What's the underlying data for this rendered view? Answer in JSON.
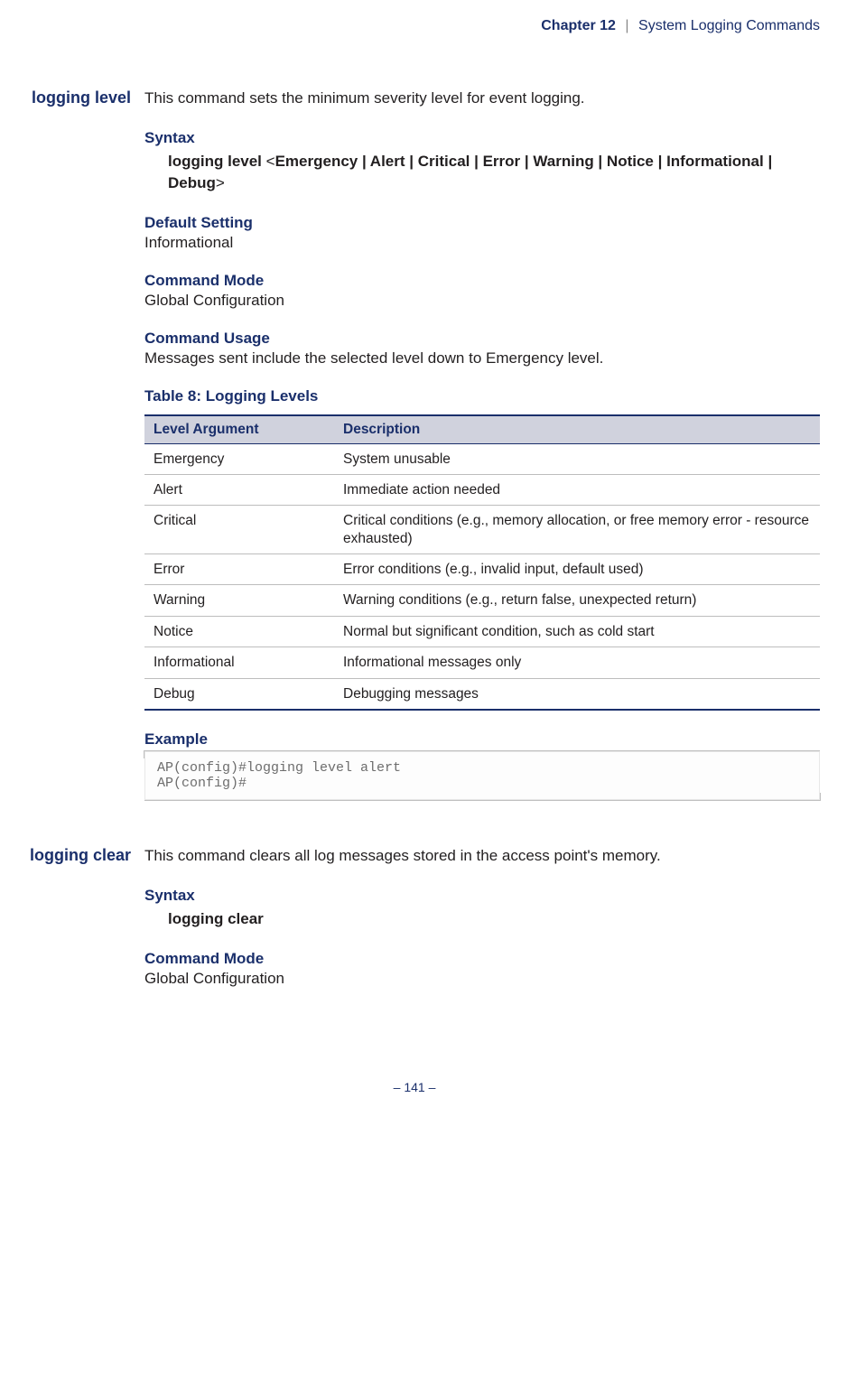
{
  "header": {
    "chapter": "Chapter 12",
    "sep": "|",
    "title": "System Logging Commands"
  },
  "cmd1": {
    "side": "logging level",
    "desc": "This command sets the minimum severity level for event logging.",
    "syntax_h": "Syntax",
    "syntax_lead": "logging level",
    "syntax_opts": "Emergency | Alert | Critical | Error | Warning | Notice | Informational | Debug",
    "default_h": "Default Setting",
    "default_v": "Informational",
    "mode_h": "Command Mode",
    "mode_v": "Global Configuration",
    "usage_h": "Command Usage",
    "usage_v": "Messages sent include the selected level down to Emergency level.",
    "table_title": "Table 8: Logging Levels",
    "table_col1": "Level Argument",
    "table_col2": "Description",
    "levels": [
      {
        "arg": "Emergency",
        "desc": "System unusable"
      },
      {
        "arg": "Alert",
        "desc": "Immediate action needed"
      },
      {
        "arg": "Critical",
        "desc": "Critical conditions (e.g., memory allocation, or free memory error - resource exhausted)"
      },
      {
        "arg": "Error",
        "desc": "Error conditions (e.g., invalid input, default used)"
      },
      {
        "arg": "Warning",
        "desc": "Warning conditions (e.g., return false, unexpected return)"
      },
      {
        "arg": "Notice",
        "desc": "Normal but significant condition, such as cold start"
      },
      {
        "arg": "Informational",
        "desc": "Informational messages only"
      },
      {
        "arg": "Debug",
        "desc": "Debugging messages"
      }
    ],
    "example_h": "Example",
    "example_code": "AP(config)#logging level alert\nAP(config)#"
  },
  "cmd2": {
    "side": "logging clear",
    "desc": "This command clears all log messages stored in the access point's memory.",
    "syntax_h": "Syntax",
    "syntax_line": "logging clear",
    "mode_h": "Command Mode",
    "mode_v": "Global Configuration"
  },
  "footer": "–  141  –"
}
